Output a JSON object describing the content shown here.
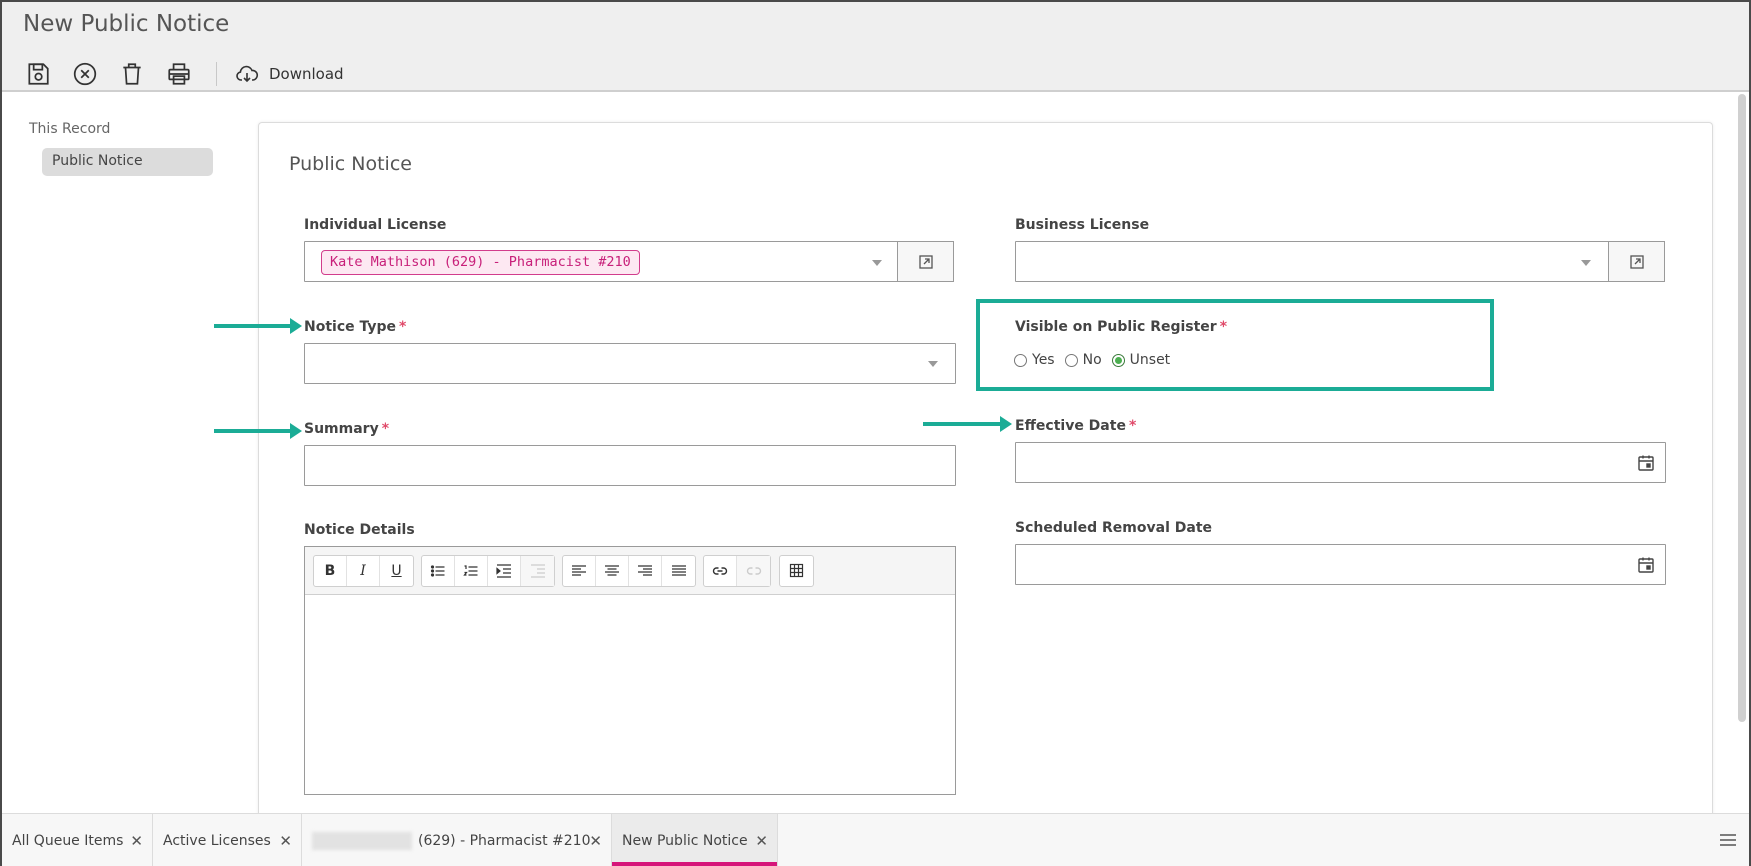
{
  "page_title": "New Public Notice",
  "toolbar": {
    "items": [
      "save-icon",
      "cancel-icon",
      "delete-icon",
      "print-icon"
    ],
    "download_label": "Download"
  },
  "sidebar": {
    "heading": "This Record",
    "items": [
      {
        "label": "Public Notice"
      }
    ]
  },
  "panel": {
    "title": "Public Notice",
    "individual_license": {
      "label": "Individual License",
      "value": "Kate Mathison (629) - Pharmacist #210"
    },
    "business_license": {
      "label": "Business License",
      "value": ""
    },
    "notice_type": {
      "label": "Notice Type",
      "required": "*",
      "value": ""
    },
    "visible_on_register": {
      "label": "Visible on Public Register",
      "required": "*",
      "options": [
        "Yes",
        "No",
        "Unset"
      ],
      "selected": "Unset"
    },
    "summary": {
      "label": "Summary",
      "required": "*",
      "value": ""
    },
    "effective_date": {
      "label": "Effective Date",
      "required": "*",
      "value": ""
    },
    "notice_details": {
      "label": "Notice Details"
    },
    "scheduled_removal_date": {
      "label": "Scheduled Removal Date",
      "value": ""
    },
    "editor_buttons": {
      "bold": "B",
      "italic": "I",
      "underline": "U"
    }
  },
  "tabs": [
    {
      "label": "All Queue Items"
    },
    {
      "label": "Active Licenses"
    },
    {
      "label": "(629) - Pharmacist #210"
    },
    {
      "label": "New Public Notice"
    }
  ],
  "colors": {
    "accent": "#d6157a",
    "highlight": "#1bac96",
    "required": "#e04a6a"
  }
}
